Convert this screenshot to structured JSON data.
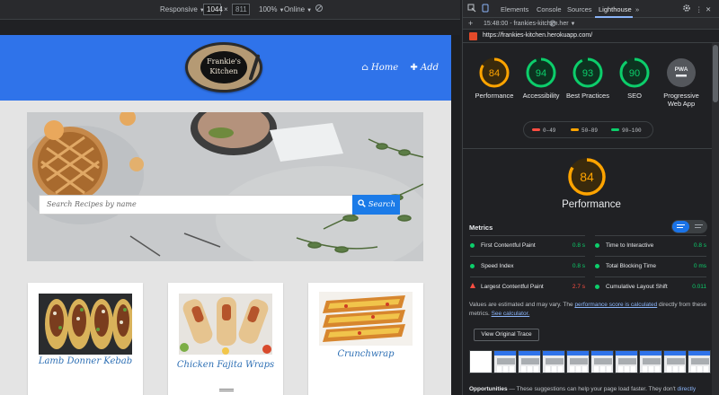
{
  "device_toolbar": {
    "mode": "Responsive",
    "width": "1044",
    "times": "×",
    "height": "811",
    "zoom": "100%",
    "network": "Online"
  },
  "site": {
    "logo_line1": "Frankie's",
    "logo_line2": "Kitchen",
    "nav_home": "Home",
    "nav_add": "Add",
    "search_placeholder": "Search Recipes by name",
    "search_button": "Search",
    "cards": [
      {
        "title": "Lamb Donner Kebab"
      },
      {
        "title": "Chicken Fajita Wraps"
      },
      {
        "title": "Crunchwrap"
      }
    ]
  },
  "devtools": {
    "tabs": [
      "Elements",
      "Console",
      "Sources",
      "Lighthouse"
    ],
    "more": "»",
    "report_selector": "15:48:00 - frankies-kitchen.her",
    "url": "https://frankies-kitchen.herokuapp.com/",
    "gauges": [
      {
        "label": "Performance",
        "score": 84,
        "color": "#ffa400"
      },
      {
        "label": "Accessibility",
        "score": 94,
        "color": "#0cce6b"
      },
      {
        "label": "Best Practices",
        "score": 93,
        "color": "#0cce6b"
      },
      {
        "label": "SEO",
        "score": 90,
        "color": "#0cce6b"
      },
      {
        "label": "Progressive Web App",
        "badge": "PWA"
      }
    ],
    "legend": [
      {
        "range": "0–49",
        "color": "#ff4e42"
      },
      {
        "range": "50–89",
        "color": "#ffa400"
      },
      {
        "range": "90–100",
        "color": "#0cce6b"
      }
    ],
    "performance": {
      "score": 84,
      "label": "Performance",
      "color": "#ffa400"
    },
    "metrics_title": "Metrics",
    "metrics": [
      {
        "name": "First Contentful Paint",
        "value": "0.8 s",
        "status": "good"
      },
      {
        "name": "Time to Interactive",
        "value": "0.8 s",
        "status": "good"
      },
      {
        "name": "Speed Index",
        "value": "0.8 s",
        "status": "good"
      },
      {
        "name": "Total Blocking Time",
        "value": "0 ms",
        "status": "good"
      },
      {
        "name": "Largest Contentful Paint",
        "value": "2.7 s",
        "status": "bad"
      },
      {
        "name": "Cumulative Layout Shift",
        "value": "0.011",
        "status": "good"
      }
    ],
    "note_part1": "Values are estimated and may vary. The",
    "note_link1": "performance score is calculated",
    "note_part2": "directly from these metrics.",
    "note_link2": "See calculator.",
    "trace_button": "View Original Trace",
    "opportunities_title": "Opportunities",
    "opportunities_text": "— These suggestions can help your page load faster. They don't",
    "opportunities_link": "directly"
  },
  "colors": {
    "header_blue": "#2f73ea",
    "search_blue": "#1b7be8",
    "card_title": "#2d6fb4",
    "good": "#0cce6b",
    "average": "#ffa400",
    "poor": "#ff4e42"
  }
}
